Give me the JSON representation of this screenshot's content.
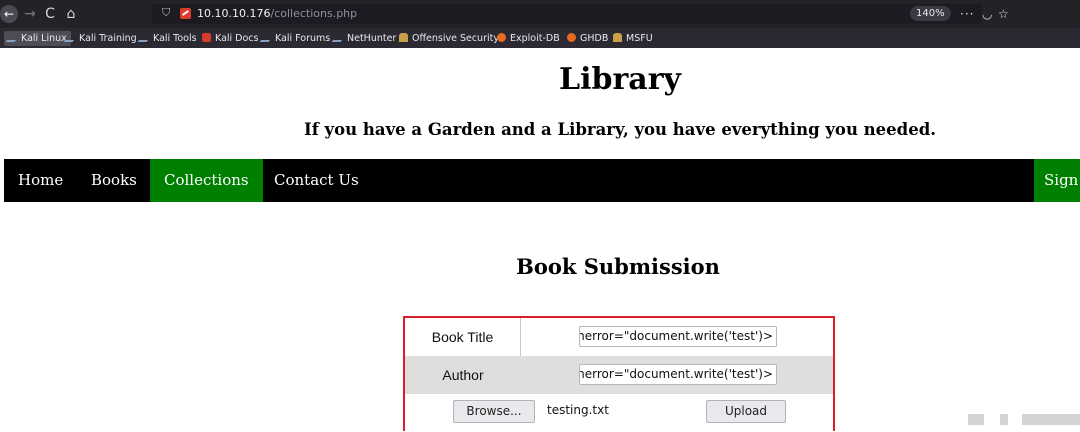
{
  "browser": {
    "back_icon": "←",
    "forward_icon": "→",
    "reload_icon": "C",
    "home_icon": "⌂",
    "url_host": "10.10.10.176",
    "url_path": "/collections.php",
    "zoom": "140%",
    "menu_icon": "···",
    "pocket_icon": "◡",
    "star_icon": "☆"
  },
  "bookmarks": [
    {
      "label": "Kali Linux",
      "icon": "kali-icon"
    },
    {
      "label": "Kali Training",
      "icon": "kali-icon"
    },
    {
      "label": "Kali Tools",
      "icon": "kali-icon"
    },
    {
      "label": "Kali Docs",
      "icon": "kali-docs-icon"
    },
    {
      "label": "Kali Forums",
      "icon": "kali-icon"
    },
    {
      "label": "NetHunter",
      "icon": "kali-icon"
    },
    {
      "label": "Offensive Security",
      "icon": "offsec-icon"
    },
    {
      "label": "Exploit-DB",
      "icon": "exploitdb-icon"
    },
    {
      "label": "GHDB",
      "icon": "ghdb-icon"
    },
    {
      "label": "MSFU",
      "icon": "msfu-icon"
    }
  ],
  "site": {
    "title": "Library",
    "tagline": "If you have a Garden and a Library, you have everything you needed."
  },
  "nav": {
    "items": [
      "Home",
      "Books",
      "Collections",
      "Contact Us"
    ],
    "active": "Collections",
    "signin": "Sign In"
  },
  "section_title": "Book Submission",
  "form": {
    "book_title_label": "Book Title",
    "book_title_value": "<img src=x onerror=\"document.write('test')\" />",
    "author_label": "Author",
    "author_value": "<img src=x onerror=\"document.write('test')\" />",
    "browse_label": "Browse...",
    "file_name": "testing.txt",
    "upload_label": "Upload"
  },
  "colors": {
    "nav_bg": "#000000",
    "nav_active": "#008000",
    "form_border": "#dc1e2a",
    "row_alt": "#dedede"
  }
}
